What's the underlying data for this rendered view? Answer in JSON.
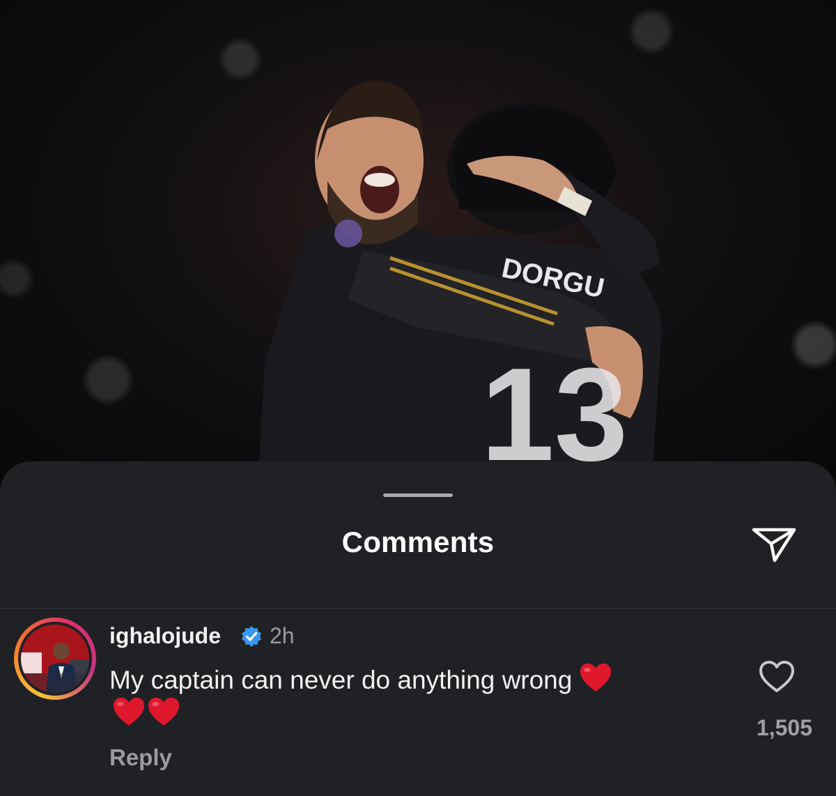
{
  "sheet": {
    "title": "Comments"
  },
  "comment": {
    "username": "ighalojude",
    "verified": true,
    "time": "2h",
    "text": "My captain can never do anything wrong",
    "emoji_count": 3,
    "reply_label": "Reply",
    "likes": "1,505"
  },
  "photo": {
    "jersey_name": "DORGU",
    "jersey_number": "13"
  },
  "icons": {
    "share": "paper-plane-icon",
    "verified": "verified-badge-icon",
    "like": "heart-outline-icon",
    "emoji": "red-heart-emoji"
  },
  "colors": {
    "sheet_background": "#202124",
    "verified_blue": "#3897f0",
    "heart_red": "#e0182d",
    "text_primary": "#f2f2f2",
    "text_secondary": "#9a9ba0"
  }
}
